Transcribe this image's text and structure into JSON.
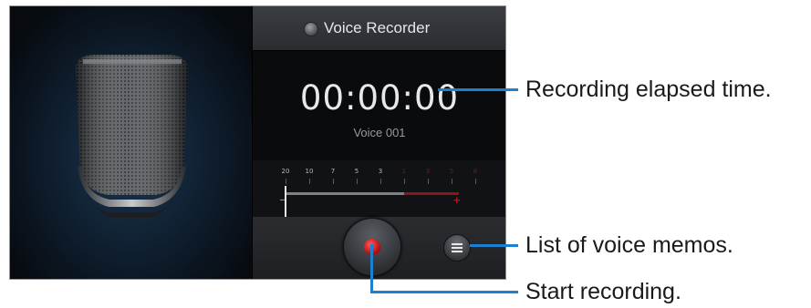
{
  "app": {
    "title": "Voice Recorder",
    "elapsed_time": "00:00:00",
    "file_name": "Voice 001"
  },
  "meter": {
    "scale_labels": [
      "20",
      "10",
      "7",
      "5",
      "3",
      "1",
      "3",
      "5",
      "8"
    ],
    "level": 0,
    "colors": {
      "normal": "#7f8185",
      "peak": "#8c1518"
    }
  },
  "controls": {
    "record_icon": "record-dot",
    "list_icon": "list-icon"
  },
  "callouts": {
    "elapsed": "Recording elapsed time.",
    "list": "List of voice memos.",
    "record": "Start recording."
  },
  "colors": {
    "callout_line": "#1c7fd0",
    "record": "#d0121a"
  }
}
